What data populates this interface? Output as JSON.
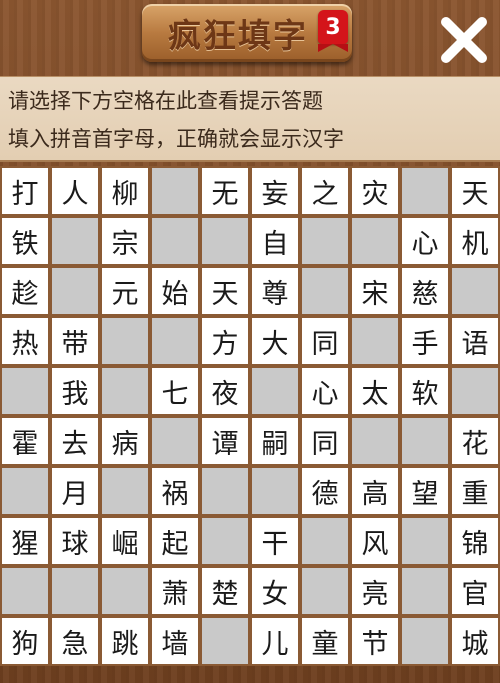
{
  "header": {
    "title": "疯狂填字",
    "level_badge": "3",
    "close_icon": "close-icon"
  },
  "hint_bar": {
    "line1": "请选择下方空格在此查看提示答题",
    "line2": "填入拼音首字母，正确就会显示汉字"
  },
  "colors": {
    "background": "#7a4a26",
    "hint_bar": "#e8d5bd",
    "cell_filled": "#ffffff",
    "cell_empty": "#c9c9c9",
    "badge": "#d4141a"
  },
  "grid": {
    "rows": [
      [
        "打",
        "人",
        "柳",
        "",
        "无",
        "妄",
        "之",
        "灾",
        "",
        "天"
      ],
      [
        "铁",
        "",
        "宗",
        "",
        "",
        "自",
        "",
        "",
        "心",
        "机"
      ],
      [
        "趁",
        "",
        "元",
        "始",
        "天",
        "尊",
        "",
        "宋",
        "慈",
        ""
      ],
      [
        "热",
        "带",
        "",
        "",
        "方",
        "大",
        "同",
        "",
        "手",
        "语"
      ],
      [
        "",
        "我",
        "",
        "七",
        "夜",
        "",
        "心",
        "太",
        "软",
        ""
      ],
      [
        "霍",
        "去",
        "病",
        "",
        "谭",
        "嗣",
        "同",
        "",
        "",
        "花"
      ],
      [
        "",
        "月",
        "",
        "祸",
        "",
        "",
        "德",
        "高",
        "望",
        "重"
      ],
      [
        "猩",
        "球",
        "崛",
        "起",
        "",
        "干",
        "",
        "风",
        "",
        "锦"
      ],
      [
        "",
        "",
        "",
        "萧",
        "楚",
        "女",
        "",
        "亮",
        "",
        "官"
      ],
      [
        "狗",
        "急",
        "跳",
        "墙",
        "",
        "儿",
        "童",
        "节",
        "",
        "城"
      ]
    ]
  }
}
